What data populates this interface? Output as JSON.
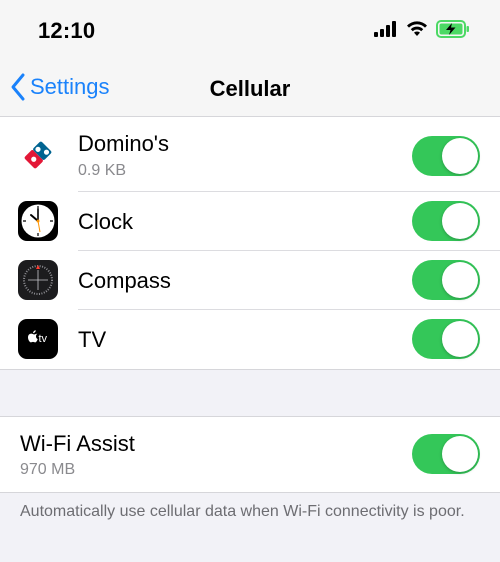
{
  "status_bar": {
    "time": "12:10"
  },
  "nav": {
    "back_label": "Settings",
    "title": "Cellular"
  },
  "apps": [
    {
      "name": "Domino's",
      "detail": "0.9 KB",
      "icon": "dominos-icon",
      "enabled": true
    },
    {
      "name": "Clock",
      "detail": "",
      "icon": "clock-icon",
      "enabled": true
    },
    {
      "name": "Compass",
      "detail": "",
      "icon": "compass-icon",
      "enabled": true
    },
    {
      "name": "TV",
      "detail": "",
      "icon": "apple-tv-icon",
      "enabled": true
    }
  ],
  "wifi_assist": {
    "label": "Wi-Fi Assist",
    "detail": "970 MB",
    "enabled": true
  },
  "footer_text": "Automatically use cellular data when Wi-Fi connectivity is poor.",
  "colors": {
    "accent": "#1a82fb",
    "toggle_on": "#34c759",
    "background": "#f2f2f7"
  }
}
